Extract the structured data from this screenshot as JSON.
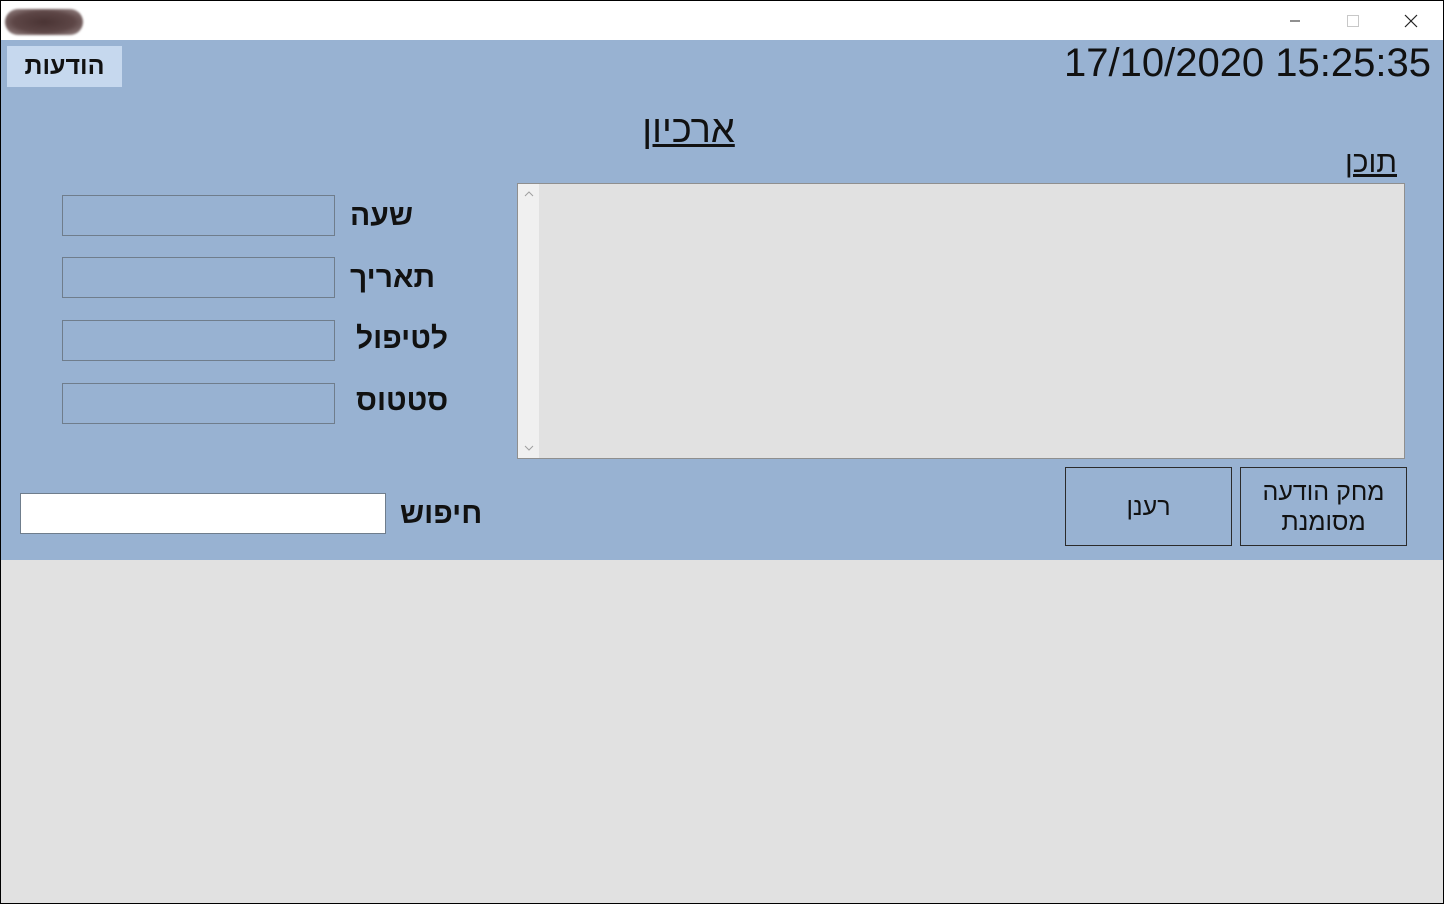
{
  "window": {
    "icons": {
      "minimize": "minimize-icon",
      "maximize": "maximize-icon",
      "close": "close-icon"
    }
  },
  "header": {
    "notifications_label": "הודעות",
    "datetime": "17/10/2020 15:25:35",
    "page_title": "ארכיון"
  },
  "content": {
    "label": "תוכן",
    "value": ""
  },
  "fields": {
    "time_label": "שעה",
    "time_value": "",
    "date_label": "תאריך",
    "date_value": "",
    "handling_label": "לטיפול",
    "handling_value": "",
    "status_label": "סטטוס",
    "status_value": ""
  },
  "search": {
    "label": "חיפוש",
    "value": ""
  },
  "actions": {
    "refresh_label": "רענן",
    "delete_marked_label": "מחק הודעה מסומנת"
  },
  "colors": {
    "panel_bg": "#98b2d2",
    "notif_button_bg": "#c6d8ee",
    "window_bg": "#e1e1e1"
  }
}
